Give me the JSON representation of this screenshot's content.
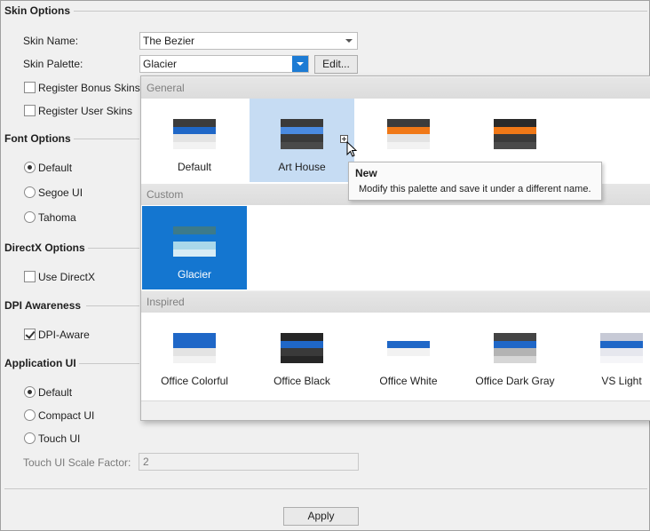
{
  "sections": {
    "skin_options": "Skin Options",
    "font_options": "Font Options",
    "directx_options": "DirectX Options",
    "dpi_awareness": "DPI Awareness",
    "application_ui": "Application UI"
  },
  "skin": {
    "name_label": "Skin Name:",
    "name_value": "The Bezier",
    "palette_label": "Skin Palette:",
    "palette_value": "Glacier",
    "edit_button": "Edit...",
    "register_bonus": {
      "label": "Register Bonus Skins",
      "checked": false
    },
    "register_user": {
      "label": "Register User Skins",
      "checked": false
    }
  },
  "font": {
    "options": [
      {
        "label": "Default",
        "checked": true
      },
      {
        "label": "Segoe UI",
        "checked": false
      },
      {
        "label": "Tahoma",
        "checked": false
      }
    ]
  },
  "directx": {
    "label": "Use DirectX",
    "checked": false
  },
  "dpi": {
    "label": "DPI-Aware",
    "checked": true
  },
  "app_ui": {
    "options": [
      {
        "label": "Default",
        "checked": true
      },
      {
        "label": "Compact UI",
        "checked": false
      },
      {
        "label": "Touch UI",
        "checked": false
      }
    ],
    "scale_label": "Touch UI Scale Factor:",
    "scale_value": "2"
  },
  "apply_button": "Apply",
  "palette_popup": {
    "groups": [
      {
        "header": "General",
        "tiles": [
          {
            "label": "Default",
            "state": "normal",
            "colors": [
              "#3c3c3c",
              "#1f67c7",
              "#e3e3e3",
              "#f2f2f2"
            ]
          },
          {
            "label": "Art House",
            "state": "hover",
            "colors": [
              "#3a3a3a",
              "#4a8ae0",
              "#3a3a3a",
              "#4a4a4a"
            ]
          },
          {
            "label": "",
            "state": "normal",
            "colors": [
              "#3c3c3c",
              "#f07817",
              "#e3e3e3",
              "#f2f2f2"
            ]
          },
          {
            "label": "",
            "state": "normal",
            "colors": [
              "#2a2a2a",
              "#f07817",
              "#3a3a3a",
              "#4a4a4a"
            ]
          }
        ]
      },
      {
        "header": "Custom",
        "tiles": [
          {
            "label": "Glacier",
            "state": "selected",
            "colors": [
              "#3c7a8a",
              "#1476d0",
              "#a9d8ea",
              "#d7ecf5"
            ]
          }
        ]
      },
      {
        "header": "Inspired",
        "tiles": [
          {
            "label": "Office Colorful",
            "state": "normal",
            "colors": [
              "#1f67c7",
              "#1f67c7",
              "#e3e3e3",
              "#f2f2f2"
            ]
          },
          {
            "label": "Office Black",
            "state": "normal",
            "colors": [
              "#262626",
              "#1f67c7",
              "#3a3a3a",
              "#262626"
            ]
          },
          {
            "label": "Office White",
            "state": "normal",
            "colors": [
              "#ffffff",
              "#1f67c7",
              "#f2f2f2",
              "#ffffff"
            ]
          },
          {
            "label": "Office Dark Gray",
            "state": "normal",
            "colors": [
              "#444444",
              "#1f67c7",
              "#b3b3b3",
              "#d6d6d6"
            ]
          },
          {
            "label": "VS Light",
            "state": "normal",
            "colors": [
              "#c7cad6",
              "#1f67c7",
              "#e6e7ee",
              "#f5f5f8"
            ]
          }
        ]
      }
    ]
  },
  "tooltip": {
    "title": "New",
    "text": "Modify this palette and save it under a different name."
  },
  "icons": {
    "dropdown": "chevron-down-icon",
    "add_palette": "plus-icon",
    "cursor": "mouse-pointer-icon"
  }
}
